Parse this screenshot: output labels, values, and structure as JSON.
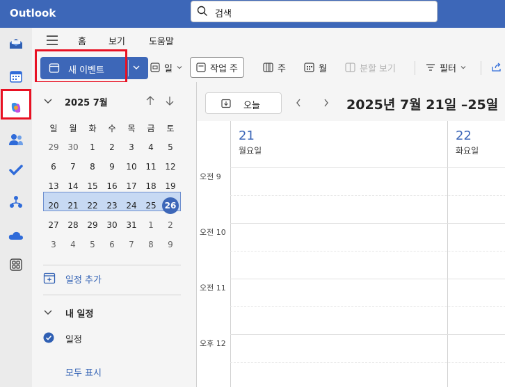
{
  "app": {
    "title": "Outlook"
  },
  "search": {
    "placeholder": "검색"
  },
  "rail": {
    "items": [
      "mail-icon",
      "calendar-icon",
      "copilot-icon",
      "people-icon",
      "todo-icon",
      "org-icon",
      "onedrive-icon",
      "apps-icon"
    ]
  },
  "ribbon_tabs": [
    "홈",
    "보기",
    "도움말"
  ],
  "ribbon": {
    "new_event": "새 이벤트",
    "day": "일",
    "work_week": "작업 주",
    "week": "주",
    "month": "월",
    "split_view": "분할 보기",
    "filter": "필터"
  },
  "mini_calendar": {
    "title": "2025 7월",
    "weekdays": [
      "일",
      "월",
      "화",
      "수",
      "목",
      "금",
      "토"
    ],
    "weeks": [
      [
        "29",
        "30",
        "1",
        "2",
        "3",
        "4",
        "5"
      ],
      [
        "6",
        "7",
        "8",
        "9",
        "10",
        "11",
        "12"
      ],
      [
        "13",
        "14",
        "15",
        "16",
        "17",
        "18",
        "19"
      ],
      [
        "20",
        "21",
        "22",
        "23",
        "24",
        "25",
        "26"
      ],
      [
        "27",
        "28",
        "29",
        "30",
        "31",
        "1",
        "2"
      ],
      [
        "3",
        "4",
        "5",
        "6",
        "7",
        "8",
        "9"
      ]
    ],
    "today": "26"
  },
  "pane": {
    "add_calendar": "일정 추가",
    "my_calendars": "내 일정",
    "calendar_item": "일정",
    "show_all": "모두 표시"
  },
  "calendar": {
    "today_label": "오늘",
    "date_range": "2025년 7월 21일 –25일",
    "days": [
      {
        "num": "21",
        "name": "월요일"
      },
      {
        "num": "22",
        "name": "화요일"
      }
    ],
    "times": [
      "오전 9",
      "오전 10",
      "오전 11",
      "오후 12"
    ]
  },
  "colors": {
    "brand": "#3d67b8",
    "highlight": "#e81123",
    "week_band": "#c7d9f3"
  }
}
